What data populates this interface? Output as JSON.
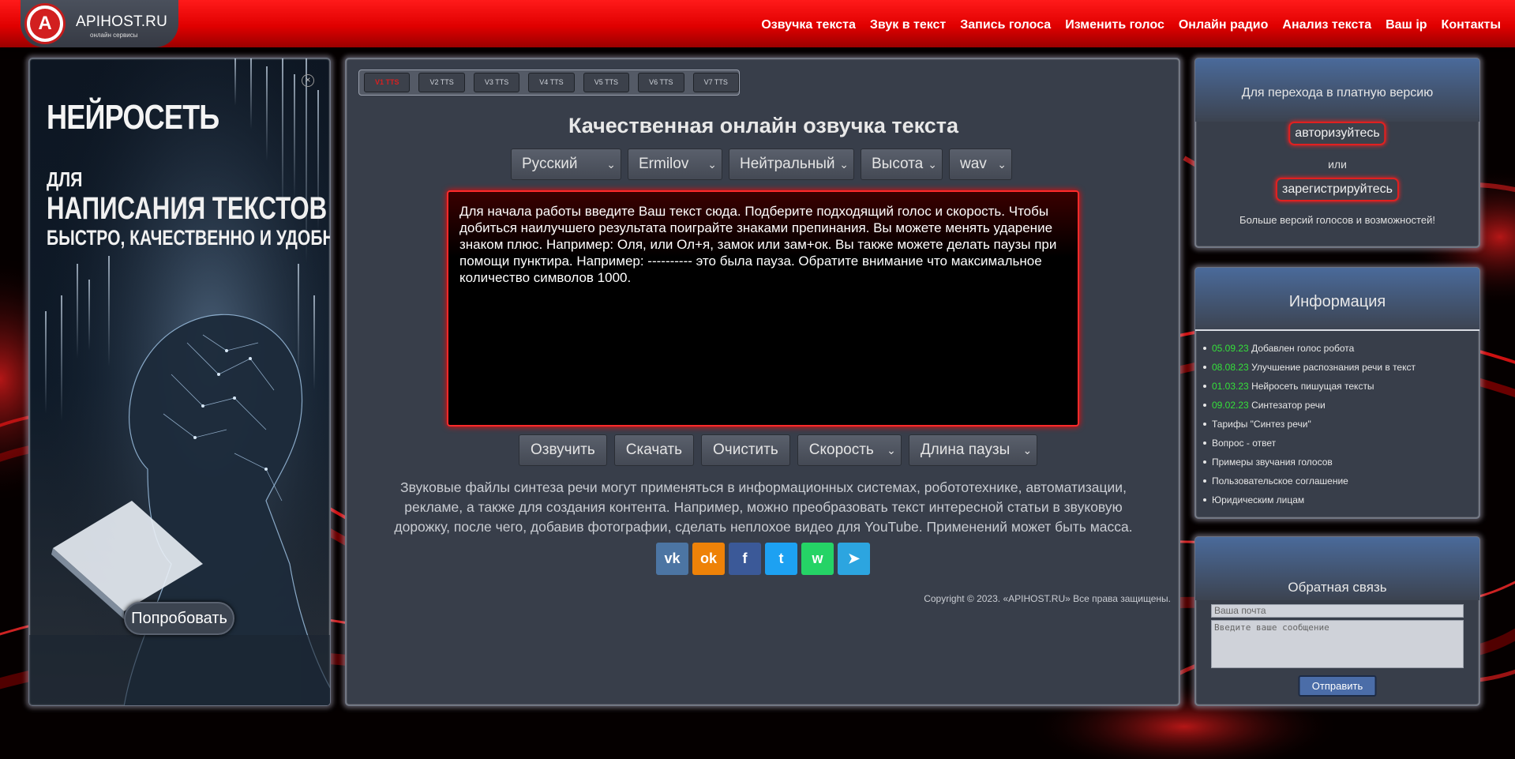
{
  "header": {
    "logo_letter": "A",
    "logo_text": "APIHOST.RU",
    "logo_sub": "онлайн сервисы",
    "nav": [
      "Озвучка текста",
      "Звук в текст",
      "Запись голоса",
      "Изменить голос",
      "Онлайн радио",
      "Анализ текста",
      "Ваш ip",
      "Контакты"
    ]
  },
  "ad": {
    "close": "×",
    "title": "НЕЙРОСЕТЬ",
    "line1": "ДЛЯ",
    "line2": "НАПИСАНИЯ ТЕКСТОВ",
    "line3": "БЫСТРО, КАЧЕСТВЕННО И УДОБНО!",
    "button": "Попробовать"
  },
  "main": {
    "tabs": [
      "V1 TTS",
      "V2 TTS",
      "V3 TTS",
      "V4 TTS",
      "V5 TTS",
      "V6 TTS",
      "V7 TTS"
    ],
    "active_tab": "V1 TTS",
    "title": "Качественная онлайн озвучка текста",
    "selects": {
      "language": "Русский",
      "voice": "Ermilov",
      "emotion": "Нейтральный",
      "pitch": "Высота",
      "format": "wav"
    },
    "textarea": "Для начала работы введите Ваш текст сюда. Подберите подходящий голос и скорость. Чтобы добиться наилучшего результата поиграйте знаками препинания. Вы можете менять ударение знаком плюс. Например: Оля, или Ол+я, замок или зам+ок. Вы также можете делать паузы при помощи пунктира. Например: ---------- это была пауза. Обратите внимание что максимальное количество символов 1000.",
    "actions": {
      "voice_btn": "Озвучить",
      "download_btn": "Скачать",
      "clear_btn": "Очистить",
      "speed": "Скорость",
      "pause_len": "Длина паузы"
    },
    "description": "Звуковые файлы синтеза речи могут применяться в информационных системах, робототехнике, автоматизации, рекламе, а также для создания контента. Например, можно преобразовать текст интересной статьи в звуковую дорожку, после чего, добавив фотографии, сделать неплохое видео для YouTube. Применений может быть масса.",
    "copyright": "Copyright © 2023. «APIHOST.RU» Все права защищены."
  },
  "paid": {
    "text": "Для перехода в платную версию",
    "login": "авторизуйтесь",
    "or": "или",
    "register": "зарегистрируйтесь",
    "more": "Больше версий голосов и возможностей!"
  },
  "info": {
    "title": "Информация",
    "items": [
      {
        "date": "05.09.23",
        "text": "Добавлен голос робота"
      },
      {
        "date": "08.08.23",
        "text": "Улучшение распознания речи в текст"
      },
      {
        "date": "01.03.23",
        "text": "Нейросеть пишущая тексты"
      },
      {
        "date": "09.02.23",
        "text": "Синтезатор речи"
      },
      {
        "date": "",
        "text": "Тарифы \"Синтез речи\""
      },
      {
        "date": "",
        "text": "Вопрос - ответ"
      },
      {
        "date": "",
        "text": "Примеры звучания голосов"
      },
      {
        "date": "",
        "text": "Пользовательское соглашение"
      },
      {
        "date": "",
        "text": "Юридическим лицам"
      }
    ]
  },
  "feedback": {
    "title": "Обратная связь",
    "email_placeholder": "Ваша почта",
    "message_placeholder": "Введите ваше сообщение",
    "send": "Отправить"
  },
  "social": [
    {
      "name": "vk-icon",
      "glyph": "vk",
      "color": "#4c75a3"
    },
    {
      "name": "odnoklassniki-icon",
      "glyph": "ok",
      "color": "#ee8208"
    },
    {
      "name": "facebook-icon",
      "glyph": "f",
      "color": "#3b5998"
    },
    {
      "name": "twitter-icon",
      "glyph": "t",
      "color": "#1da1f2"
    },
    {
      "name": "whatsapp-icon",
      "glyph": "w",
      "color": "#25d366"
    },
    {
      "name": "telegram-icon",
      "glyph": "➤",
      "color": "#2ca5e0"
    }
  ],
  "colors": {
    "accent": "#e00000",
    "panel": "#383e4a",
    "date_green": "#35e03a"
  }
}
